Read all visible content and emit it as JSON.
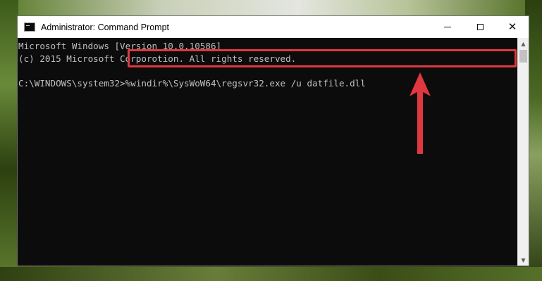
{
  "window": {
    "title": "Administrator: Command Prompt",
    "controls": {
      "minimize_icon": "minimize-icon",
      "maximize_icon": "maximize-icon",
      "close_glyph": "✕"
    }
  },
  "console": {
    "lines": [
      "Microsoft Windows [Version 10.0.10586]",
      "(c) 2015 Microsoft Corporotion. All rights reserved.",
      ""
    ],
    "prompt": "C:\\WINDOWS\\system32>",
    "command": "%windir%\\SysWoW64\\regsvr32.exe /u datfile.dll"
  },
  "annotation": {
    "highlight_color": "#e0383e",
    "arrow_color": "#e0383e"
  },
  "scrollbar": {
    "up_glyph": "▲",
    "down_glyph": "▼"
  }
}
